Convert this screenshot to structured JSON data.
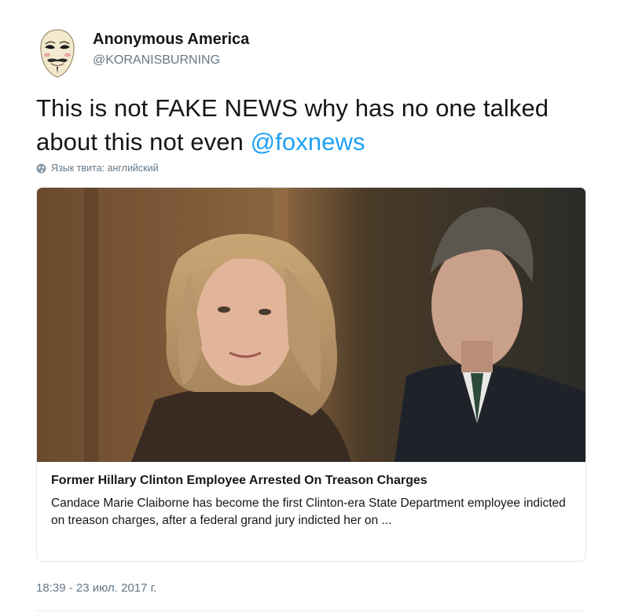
{
  "author": {
    "name": "Anonymous America",
    "handle": "@KORANISBURNING"
  },
  "tweet": {
    "text_main": "This is not FAKE NEWS why has no one talked about this not even ",
    "mention": "@foxnews"
  },
  "translate": {
    "icon": "globe-icon",
    "label": "Язык твита: английский"
  },
  "card": {
    "title": "Former Hillary Clinton Employee Arrested On Treason Charges",
    "description": "Candace Marie Claiborne has become the first Clinton-era State Department employee indicted on treason charges, after a federal grand jury indicted her on ..."
  },
  "timestamp": "18:39 - 23 июл. 2017 г.",
  "colors": {
    "link": "#1da1f2",
    "secondary_text": "#657786",
    "border": "#e1e8ed"
  }
}
